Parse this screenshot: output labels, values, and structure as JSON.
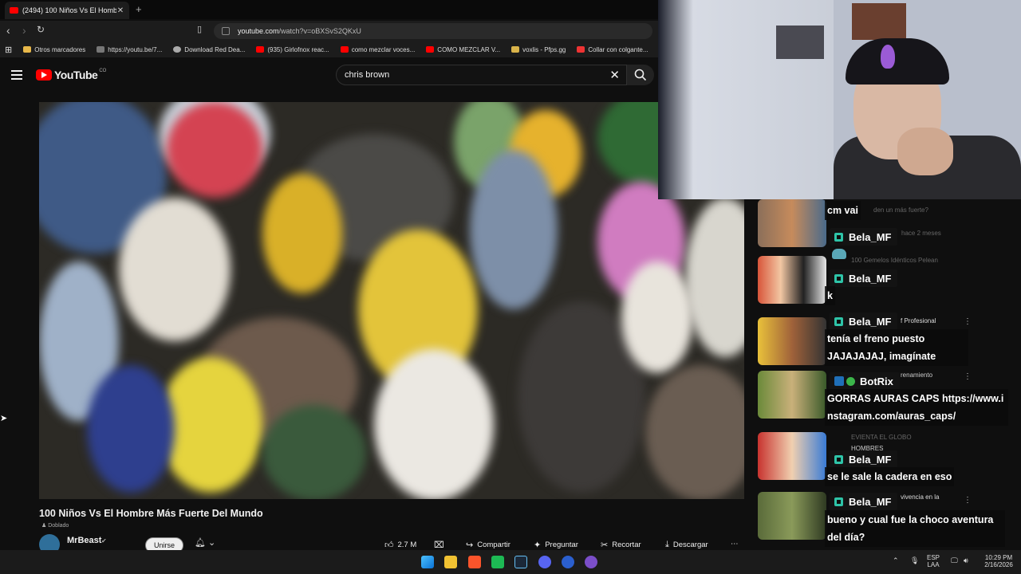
{
  "browser": {
    "tab_title": "(2494) 100 Niños Vs El Hombr...",
    "url_host": "youtube.com",
    "url_path": "/watch?v=oBXSvS2QKxU",
    "bookmarks": [
      "Otros marcadores",
      "https://youtu.be/7...",
      "Download Red Dea...",
      "(935) Girlofnox reac...",
      "como mezclar voces...",
      "COMO MEZCLAR V...",
      "voxlis - Pfps.gg",
      "Collar con colgante..."
    ]
  },
  "youtube": {
    "logo_text": "YouTube",
    "logo_region": "CO",
    "search_query": "chris brown",
    "video": {
      "title": "100 Niños Vs El Hombre Más Fuerte Del Mundo",
      "dubbed_label": "Doblado",
      "channel": "MrBeast",
      "join_label": "Unirse",
      "likes": "2.7 M",
      "actions": {
        "share": "Compartir",
        "ask": "Preguntar",
        "clip": "Recortar",
        "download": "Descargar"
      }
    },
    "side_ghost_text": [
      "den un más fuerte?",
      "hace 2 meses",
      "100 Gemelos Idénticos Pelean",
      "f Profesional",
      "renamiento",
      "EVIENTA EL GLOBO",
      "HOMBRES",
      "vivencia en la"
    ]
  },
  "chat": [
    {
      "text": "cm vai"
    },
    {
      "user": "Bela_MF"
    },
    {
      "user": "Bela_MF",
      "text": "k"
    },
    {
      "user": "Bela_MF",
      "text": "tenía el freno puesto JAJAJAJAJ, imagínate"
    },
    {
      "user": "BotRix",
      "text": "GORRAS AURAS CAPS https://www.instagram.com/auras_caps/"
    },
    {
      "user": "Bela_MF",
      "text": "se le sale la cadera en eso"
    },
    {
      "user": "Bela_MF",
      "text": "bueno y cual fue la choco aventura del día?"
    }
  ],
  "taskbar": {
    "lang_top": "ESP",
    "lang_bottom": "LAA",
    "time": "10:29 PM",
    "date": "2/16/2026"
  }
}
